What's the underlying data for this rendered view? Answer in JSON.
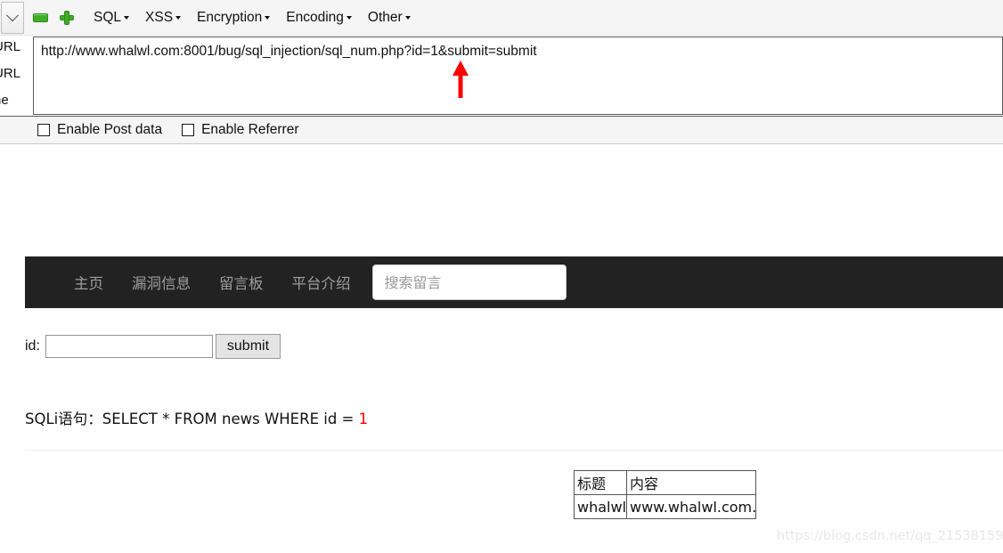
{
  "tool_window": {
    "toolbar": {
      "dropdown_icon": "chevron-down-icon",
      "remove_icon": "minus-icon",
      "add_icon": "plus-icon",
      "menus": [
        {
          "label": "SQL"
        },
        {
          "label": "XSS"
        },
        {
          "label": "Encryption"
        },
        {
          "label": "Encoding"
        },
        {
          "label": "Other"
        }
      ]
    },
    "side_labels": [
      {
        "text": "URL"
      },
      {
        "text": "URL"
      },
      {
        "text": "ne"
      }
    ],
    "url_field": {
      "value": "http://www.whalwl.com:8001/bug/sql_injection/sql_num.php?id=1&submit=submit",
      "placeholder": ""
    },
    "annotation": {
      "type": "red-arrow",
      "color": "#ff0000"
    },
    "options": [
      {
        "label": "Enable Post data",
        "checked": false
      },
      {
        "label": "Enable Referrer",
        "checked": false
      }
    ]
  },
  "page": {
    "navbar": {
      "background": "#222222",
      "links": [
        {
          "label": "主页"
        },
        {
          "label": "漏洞信息"
        },
        {
          "label": "留言板"
        },
        {
          "label": "平台介绍"
        }
      ],
      "search": {
        "placeholder": "搜索留言",
        "value": ""
      }
    },
    "form": {
      "id_label": "id:",
      "id_value": "",
      "id_placeholder": "",
      "submit_label": "submit"
    },
    "sqli": {
      "prefix": "SQLi语句：SELECT * FROM news WHERE id = ",
      "id_value": "1",
      "id_color": "#ff0000"
    },
    "result_table": {
      "headers": [
        "标题",
        "内容"
      ],
      "rows": [
        [
          "whalwl",
          "www.whalwl.com."
        ]
      ]
    },
    "watermark": "https://blog.csdn.net/qq_21538159"
  }
}
